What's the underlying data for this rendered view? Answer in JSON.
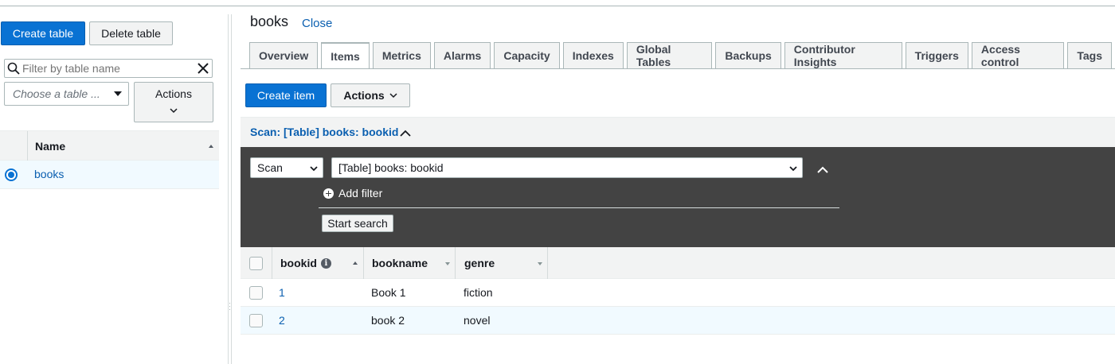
{
  "left": {
    "create_table": "Create table",
    "delete_table": "Delete table",
    "filter_placeholder": "Filter by table name",
    "choose_placeholder": "Choose a table ...",
    "actions": "Actions",
    "table_header": "Name",
    "tables": [
      {
        "name": "books",
        "selected": true
      }
    ]
  },
  "header": {
    "title": "books",
    "close": "Close"
  },
  "tabs": [
    {
      "label": "Overview"
    },
    {
      "label": "Items",
      "active": true
    },
    {
      "label": "Metrics"
    },
    {
      "label": "Alarms"
    },
    {
      "label": "Capacity"
    },
    {
      "label": "Indexes"
    },
    {
      "label": "Global Tables"
    },
    {
      "label": "Backups"
    },
    {
      "label": "Contributor Insights"
    },
    {
      "label": "Triggers"
    },
    {
      "label": "Access control"
    },
    {
      "label": "Tags"
    }
  ],
  "toolbar": {
    "create_item": "Create item",
    "actions": "Actions"
  },
  "scan": {
    "summary": "Scan: [Table] books: bookid",
    "mode": "Scan",
    "target": "[Table] books: bookid",
    "add_filter": "Add filter",
    "start_search": "Start search"
  },
  "items": {
    "columns": [
      "bookid",
      "bookname",
      "genre"
    ],
    "rows": [
      {
        "bookid": "1",
        "bookname": "Book 1",
        "genre": "fiction"
      },
      {
        "bookid": "2",
        "bookname": "book 2",
        "genre": "novel"
      }
    ]
  },
  "colors": {
    "primary": "#0972d3",
    "link": "#0a5fb0",
    "dark_panel": "#434343",
    "selected_row": "#f1faff"
  }
}
